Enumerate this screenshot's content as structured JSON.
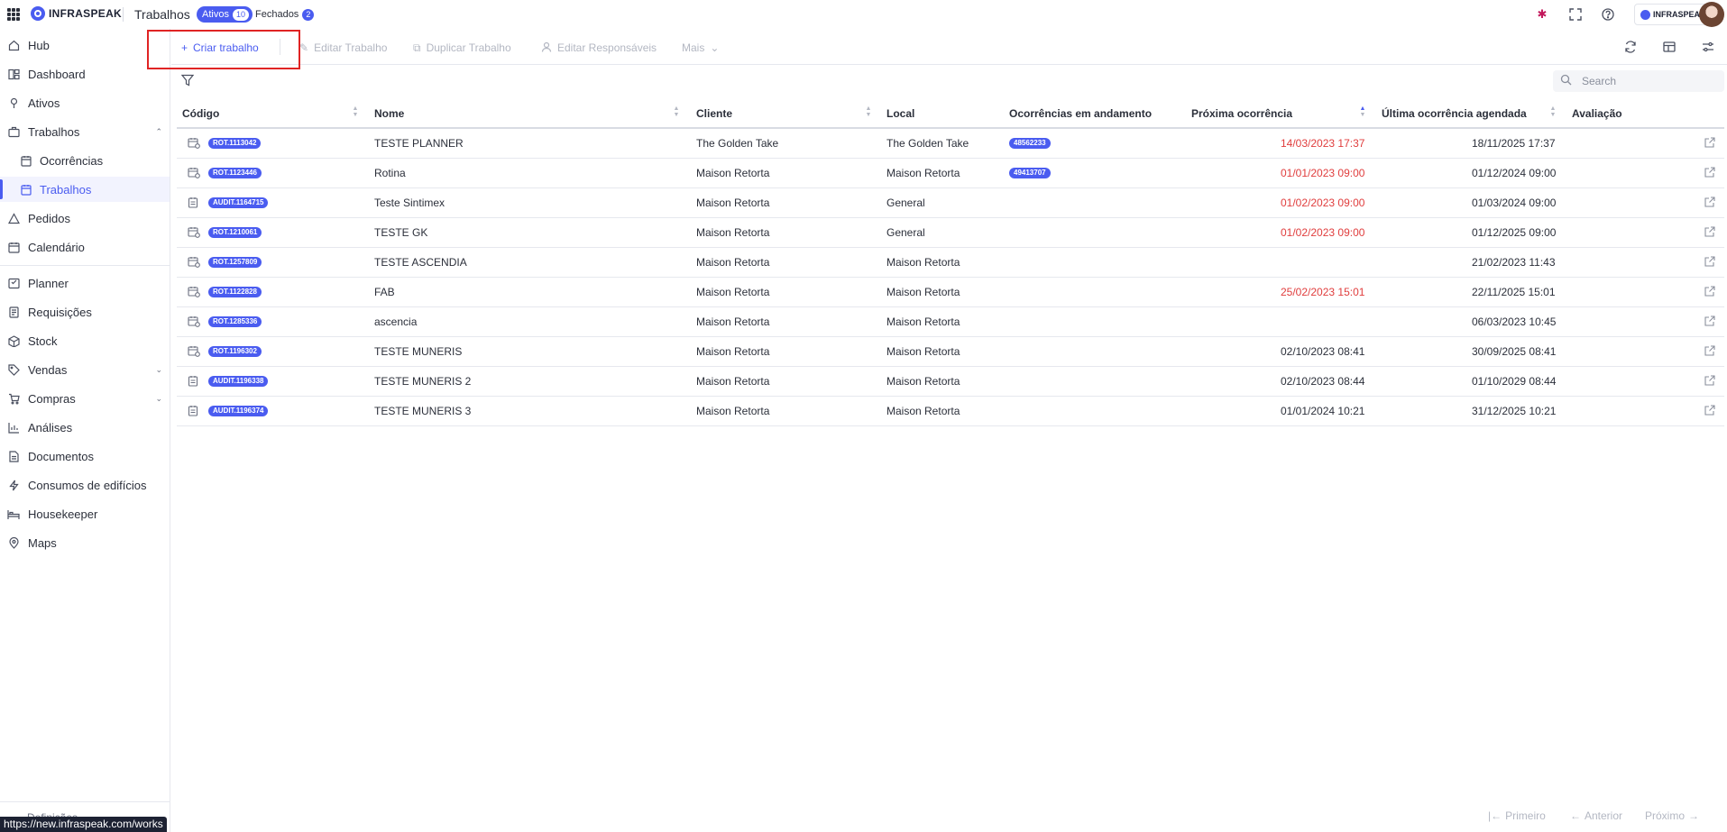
{
  "topbar": {
    "brand": "INFRASPEAK",
    "section_title": "Trabalhos",
    "tabs": [
      {
        "label": "Ativos",
        "count": "10"
      },
      {
        "label": "Fechados",
        "count": "2"
      }
    ],
    "company_chip": "INFRASPEAK",
    "icons": [
      "apps-grid-icon",
      "sparkle-icon",
      "fullscreen-icon",
      "help-icon"
    ]
  },
  "sidebar": {
    "items": [
      {
        "label": "Hub",
        "icon": "home-icon"
      },
      {
        "label": "Dashboard",
        "icon": "dashboard-icon"
      },
      {
        "label": "Ativos",
        "icon": "asset-icon"
      },
      {
        "label": "Trabalhos",
        "icon": "work-icon"
      },
      {
        "label": "Ocorrências",
        "icon": "occurrence-icon"
      },
      {
        "label": "Trabalhos",
        "icon": "calendar-work-icon"
      },
      {
        "label": "Pedidos",
        "icon": "alert-triangle-icon"
      },
      {
        "label": "Calendário",
        "icon": "calendar-icon"
      },
      {
        "label": "Planner",
        "icon": "planner-icon"
      },
      {
        "label": "Requisições",
        "icon": "requisition-icon"
      },
      {
        "label": "Stock",
        "icon": "stock-icon"
      },
      {
        "label": "Vendas",
        "icon": "tag-icon"
      },
      {
        "label": "Compras",
        "icon": "cart-icon"
      },
      {
        "label": "Análises",
        "icon": "chart-icon"
      },
      {
        "label": "Documentos",
        "icon": "document-icon"
      },
      {
        "label": "Consumos de edifícios",
        "icon": "lightning-icon"
      },
      {
        "label": "Housekeeper",
        "icon": "bed-icon"
      },
      {
        "label": "Maps",
        "icon": "map-pin-icon"
      }
    ],
    "settings_peek": "Definições",
    "status_url": "https://new.infraspeak.com/works"
  },
  "toolbar": {
    "create": "Criar trabalho",
    "edit": "Editar Trabalho",
    "duplicate": "Duplicar Trabalho",
    "edit_responsibles": "Editar Responsáveis",
    "more": "Mais"
  },
  "search": {
    "placeholder": "Search",
    "value": ""
  },
  "table": {
    "headers": {
      "code": "Código",
      "name": "Nome",
      "client": "Cliente",
      "local": "Local",
      "occurrences": "Ocorrências em andamento",
      "next": "Próxima ocorrência",
      "last": "Última ocorrência agendada",
      "rating": "Avaliação"
    },
    "rows": [
      {
        "type": "routine",
        "code": "ROT.1113042",
        "name": "TESTE PLANNER",
        "client": "The Golden Take",
        "local": "The Golden Take",
        "occurrence": "48562233",
        "next": "14/03/2023 17:37",
        "next_overdue": true,
        "last": "18/11/2025 17:37"
      },
      {
        "type": "routine",
        "code": "ROT.1123446",
        "name": "Rotina",
        "client": "Maison Retorta",
        "local": "Maison Retorta",
        "occurrence": "49413707",
        "next": "01/01/2023 09:00",
        "next_overdue": true,
        "last": "01/12/2024 09:00"
      },
      {
        "type": "audit",
        "code": "AUDIT.1164715",
        "name": "Teste Sintimex",
        "client": "Maison Retorta",
        "local": "General",
        "occurrence": "",
        "next": "01/02/2023 09:00",
        "next_overdue": true,
        "last": "01/03/2024 09:00"
      },
      {
        "type": "routine",
        "code": "ROT.1210061",
        "name": "TESTE GK",
        "client": "Maison Retorta",
        "local": "General",
        "occurrence": "",
        "next": "01/02/2023 09:00",
        "next_overdue": true,
        "last": "01/12/2025 09:00"
      },
      {
        "type": "routine",
        "code": "ROT.1257809",
        "name": "TESTE ASCENDIA",
        "client": "Maison Retorta",
        "local": "Maison Retorta",
        "occurrence": "",
        "next": "",
        "next_overdue": false,
        "last": "21/02/2023 11:43"
      },
      {
        "type": "routine",
        "code": "ROT.1122828",
        "name": "FAB",
        "client": "Maison Retorta",
        "local": "Maison Retorta",
        "occurrence": "",
        "next": "25/02/2023 15:01",
        "next_overdue": true,
        "last": "22/11/2025 15:01"
      },
      {
        "type": "routine",
        "code": "ROT.1285336",
        "name": "ascencia",
        "client": "Maison Retorta",
        "local": "Maison Retorta",
        "occurrence": "",
        "next": "",
        "next_overdue": false,
        "last": "06/03/2023 10:45"
      },
      {
        "type": "routine",
        "code": "ROT.1196302",
        "name": "TESTE MUNERIS",
        "client": "Maison Retorta",
        "local": "Maison Retorta",
        "occurrence": "",
        "next": "02/10/2023 08:41",
        "next_overdue": false,
        "last": "30/09/2025 08:41"
      },
      {
        "type": "audit",
        "code": "AUDIT.1196338",
        "name": "TESTE MUNERIS 2",
        "client": "Maison Retorta",
        "local": "Maison Retorta",
        "occurrence": "",
        "next": "02/10/2023 08:44",
        "next_overdue": false,
        "last": "01/10/2029 08:44"
      },
      {
        "type": "audit",
        "code": "AUDIT.1196374",
        "name": "TESTE MUNERIS 3",
        "client": "Maison Retorta",
        "local": "Maison Retorta",
        "occurrence": "",
        "next": "01/01/2024 10:21",
        "next_overdue": false,
        "last": "31/12/2025 10:21"
      }
    ]
  },
  "pagination": {
    "first": "Primeiro",
    "previous": "Anterior",
    "next": "Próximo"
  },
  "colors": {
    "accent": "#4a5cf0",
    "overdue": "#e03d3d",
    "highlight": "#e02424"
  }
}
